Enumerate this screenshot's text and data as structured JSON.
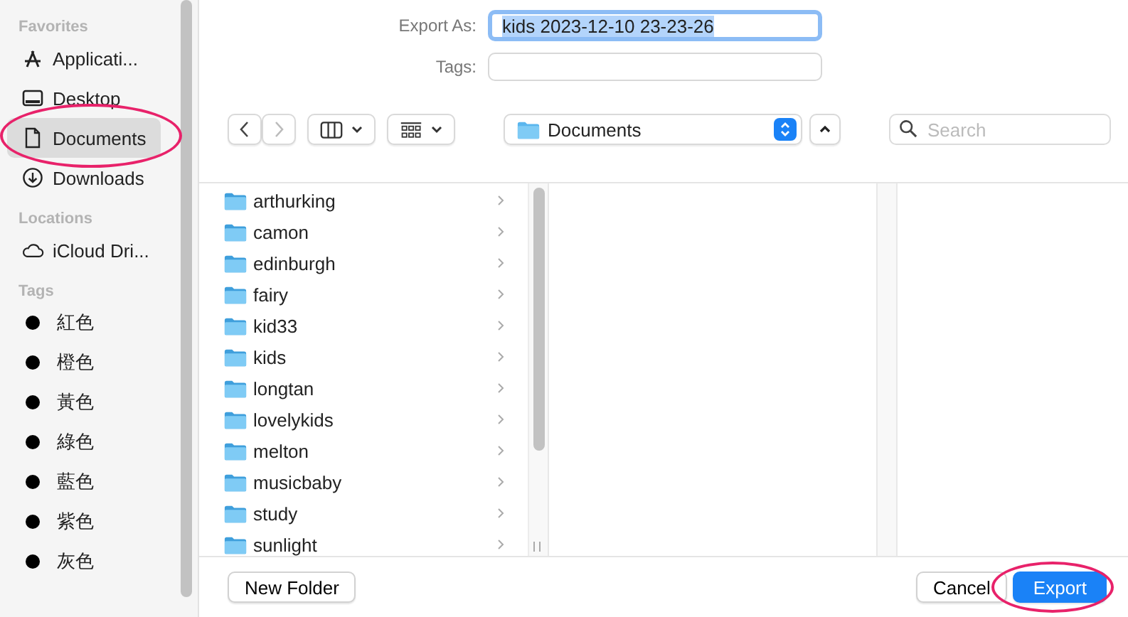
{
  "sidebar": {
    "sections": [
      {
        "title": "Favorites",
        "items": [
          {
            "label": "Applicati...",
            "kind": "apps",
            "selected": false
          },
          {
            "label": "Desktop",
            "kind": "desktop",
            "selected": false
          },
          {
            "label": "Documents",
            "kind": "document",
            "selected": true
          },
          {
            "label": "Downloads",
            "kind": "download",
            "selected": false
          }
        ]
      },
      {
        "title": "Locations",
        "items": [
          {
            "label": "iCloud Dri...",
            "kind": "cloud",
            "selected": false
          }
        ]
      },
      {
        "title": "Tags",
        "items": [
          {
            "label": "紅色",
            "kind": "tag",
            "color": "#000000",
            "selected": false
          },
          {
            "label": "橙色",
            "kind": "tag",
            "color": "#000000",
            "selected": false
          },
          {
            "label": "黃色",
            "kind": "tag",
            "color": "#000000",
            "selected": false
          },
          {
            "label": "綠色",
            "kind": "tag",
            "color": "#000000",
            "selected": false
          },
          {
            "label": "藍色",
            "kind": "tag",
            "color": "#000000",
            "selected": false
          },
          {
            "label": "紫色",
            "kind": "tag",
            "color": "#000000",
            "selected": false
          },
          {
            "label": "灰色",
            "kind": "tag",
            "color": "#000000",
            "selected": false
          }
        ]
      }
    ]
  },
  "export_as": {
    "label": "Export As:",
    "value": "kids 2023-12-10 23-23-26"
  },
  "tags": {
    "label": "Tags:"
  },
  "location": {
    "label": "Documents"
  },
  "search": {
    "placeholder": "Search"
  },
  "files": [
    "arthurking",
    "camon",
    "edinburgh",
    "fairy",
    "kid33",
    "kids",
    "longtan",
    "lovelykids",
    "melton",
    "musicbaby",
    "study",
    "sunlight"
  ],
  "buttons": {
    "new_folder": "New Folder",
    "cancel": "Cancel",
    "export": "Export"
  }
}
